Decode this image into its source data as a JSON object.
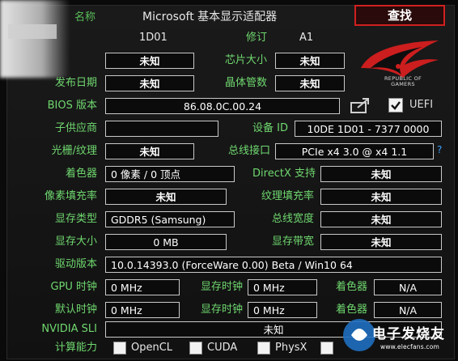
{
  "window_title": "Microsoft 基本显示适配器",
  "find_button": "查找",
  "logo": {
    "line1": "REPUBLIC OF",
    "line2": "GAMERS"
  },
  "labels": {
    "name": "名称",
    "revision": "修订",
    "chip_size": "芯片大小",
    "release_date": "发布日期",
    "transistors": "晶体管数",
    "bios_version": "BIOS 版本",
    "uefi": "UEFI",
    "subvendor": "子供应商",
    "device_id": "设备 ID",
    "rops_tmus": "光栅/纹理",
    "bus_interface": "总线接口",
    "shaders": "着色器",
    "directx": "DirectX 支持",
    "pixel_fillrate": "像素填充率",
    "texture_fillrate": "纹理填充率",
    "memory_type": "显存类型",
    "bus_width": "总线宽度",
    "memory_size": "显存大小",
    "bandwidth": "显存带宽",
    "driver_version": "驱动版本",
    "gpu_clock": "GPU 时钟",
    "mem_clock": "显存时钟",
    "shader_clock": "着色器",
    "default_clock": "默认时钟",
    "default_mem_clock": "显存时钟",
    "default_shader_clock": "着色器",
    "nvidia_sli": "NVIDIA SLI",
    "computing": "计算能力"
  },
  "values": {
    "gpu_code": "1D01",
    "revision": "A1",
    "die_size": "未知",
    "release_date": "未知",
    "transistors": "未知",
    "bios": "86.08.0C.00.24",
    "subvendor": "",
    "device_id": "10DE 1D01 - 7377 0000",
    "rops": "未知",
    "bus_interface": "PCIe x4 3.0 @ x4 1.1",
    "bus_help": "?",
    "shaders": "0 像素 / 0 顶点",
    "directx": "未知",
    "pixel_fillrate": "未知",
    "texture_fillrate": "未知",
    "memory_type": "GDDR5 (Samsung)",
    "bus_width": "未知",
    "memory_size": "0 MB",
    "bandwidth": "未知",
    "driver": "10.0.14393.0 (ForceWare 0.00) Beta / Win10 64",
    "gpu_clock": "0 MHz",
    "mem_clock": "0 MHz",
    "shader_clock": "N/A",
    "default_clock": "0 MHz",
    "default_mem_clock": "0 MHz",
    "default_shader_clock": "N/A",
    "sli": "未知"
  },
  "compute": {
    "opencl": "OpenCL",
    "cuda": "CUDA",
    "physx": "PhysX",
    "dc": "DirectCompute"
  },
  "watermark": {
    "main": "电子发烧友",
    "sub": "www.elecfans.com"
  },
  "colors": {
    "label": "#6fd86f",
    "accent": "#d02020",
    "bg": "#111111"
  }
}
